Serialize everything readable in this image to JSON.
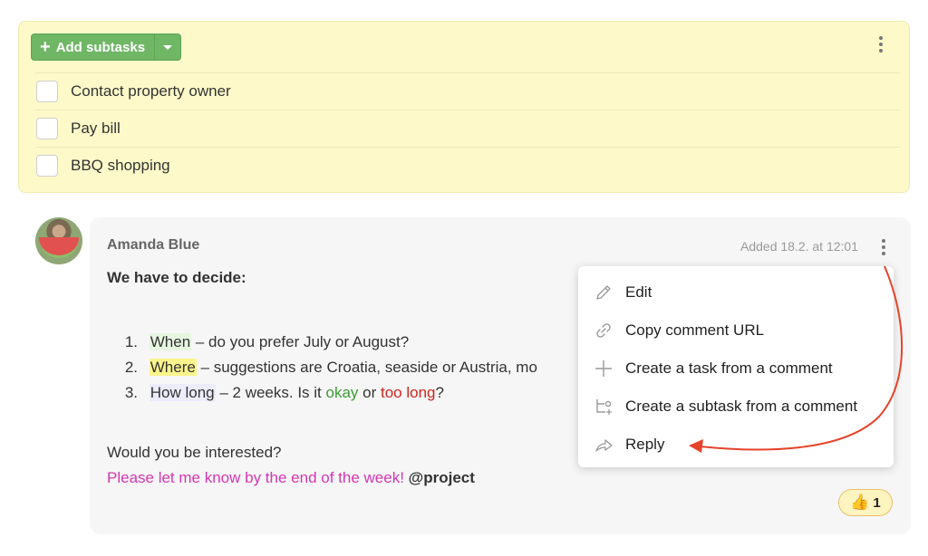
{
  "subtasks": {
    "add_button_label": "Add subtasks",
    "items": [
      {
        "label": "Contact property owner",
        "checked": false
      },
      {
        "label": "Pay bill",
        "checked": false
      },
      {
        "label": "BBQ shopping",
        "checked": false
      }
    ]
  },
  "comment": {
    "author": "Amanda Blue",
    "added": "Added 18.2. at 12:01",
    "title": "We have to decide:",
    "list": [
      {
        "num": "1.",
        "key": "When",
        "rest": " – do you prefer July or August?"
      },
      {
        "num": "2.",
        "key": "Where",
        "rest": " – suggestions are Croatia, seaside or Austria, mo"
      },
      {
        "num": "3.",
        "key": "How long",
        "rest_a": " – 2 weeks. Is it ",
        "okay": "okay",
        "or": " or ",
        "too_long": "too long",
        "end": "?"
      }
    ],
    "question": "Would you be interested?",
    "reminder": "Please let me know by the end of the week! ",
    "mention": "@project",
    "reaction": {
      "emoji": "thumbs-up",
      "count": "1"
    }
  },
  "menu": {
    "items": [
      {
        "label": "Edit",
        "icon": "pencil-icon"
      },
      {
        "label": "Copy comment URL",
        "icon": "link-icon"
      },
      {
        "label": "Create a task from a comment",
        "icon": "plus-icon"
      },
      {
        "label": "Create a subtask from a comment",
        "icon": "subtask-icon"
      },
      {
        "label": "Reply",
        "icon": "reply-icon"
      }
    ]
  },
  "colors": {
    "accent_green": "#6fb665",
    "subtasks_bg": "#fdf9c9",
    "annotation_arrow": "#e5432a",
    "mention_pink": "#d336b4"
  }
}
